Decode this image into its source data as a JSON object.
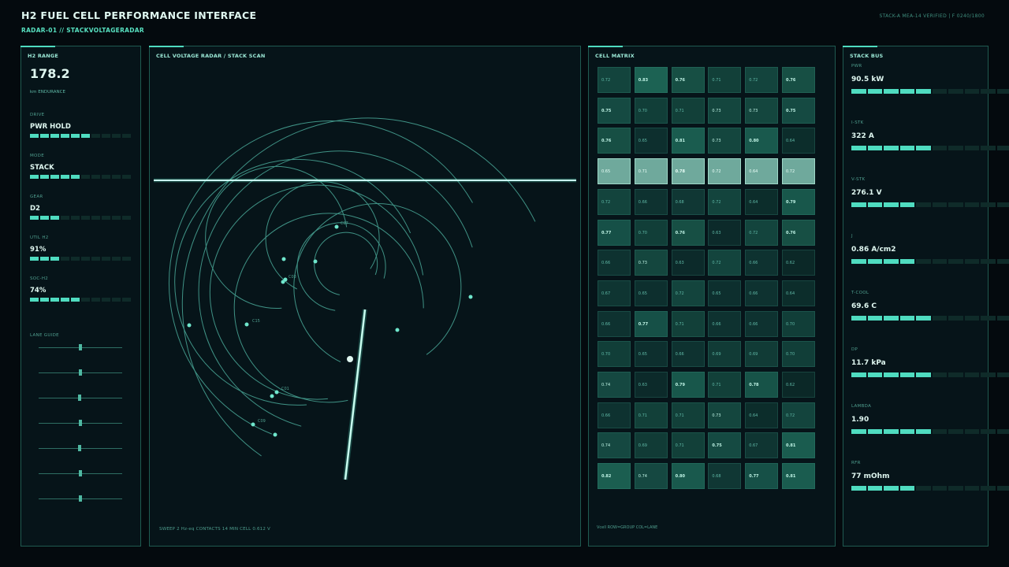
{
  "header": {
    "title": "H2 FUEL CELL PERFORMANCE INTERFACE",
    "subtitle": "RADAR-01 // STACKVOLTAGERADAR",
    "status": "STACK-A MEA-14 VERIFIED | F 0240/1800"
  },
  "left": {
    "title": "H2 RANGE",
    "range_value": "178.2",
    "range_unit": "km ENDURANCE",
    "metrics": [
      {
        "label": "DRIVE",
        "value": "PWR HOLD",
        "level": 0.6
      },
      {
        "label": "MODE",
        "value": "STACK",
        "level": 0.5
      },
      {
        "label": "GEAR",
        "value": "D2",
        "level": 0.3
      },
      {
        "label": "UTIL H2",
        "value": "91%",
        "level": 0.3
      },
      {
        "label": "SOC-H2",
        "value": "74%",
        "level": 0.5
      }
    ],
    "lane_title": "LANE GUIDE",
    "lane_levels": [
      0.5,
      0.5,
      0.49,
      0.5,
      0.49,
      0.5,
      0.5
    ]
  },
  "radar": {
    "title": "CELL VOLTAGE RADAR / STACK SCAN",
    "footer": "SWEEP  2 Hz-eq   CONTACTS 14   MIN CELL 0.612 V",
    "contacts": [
      "C07",
      "C03",
      "C15",
      "C01",
      "C09"
    ]
  },
  "matrix": {
    "title": "CELL MATRIX",
    "footer": "Vcell  ROW=GROUP  COL=LANE",
    "highlight_row": 3,
    "rows": [
      [
        "0.72",
        "0.83",
        "0.76",
        "0.71",
        "0.72",
        "0.76"
      ],
      [
        "0.75",
        "0.70",
        "0.71",
        "0.73",
        "0.73",
        "0.75"
      ],
      [
        "0.76",
        "0.65",
        "0.81",
        "0.73",
        "0.80",
        "0.64"
      ],
      [
        "0.65",
        "0.71",
        "0.78",
        "0.72",
        "0.64",
        "0.72"
      ],
      [
        "0.72",
        "0.66",
        "0.68",
        "0.72",
        "0.64",
        "0.79"
      ],
      [
        "0.77",
        "0.70",
        "0.76",
        "0.63",
        "0.72",
        "0.76"
      ],
      [
        "0.66",
        "0.73",
        "0.63",
        "0.72",
        "0.66",
        "0.62"
      ],
      [
        "0.67",
        "0.65",
        "0.72",
        "0.65",
        "0.66",
        "0.64"
      ],
      [
        "0.66",
        "0.77",
        "0.71",
        "0.66",
        "0.66",
        "0.70"
      ],
      [
        "0.70",
        "0.65",
        "0.66",
        "0.69",
        "0.69",
        "0.70"
      ],
      [
        "0.74",
        "0.63",
        "0.79",
        "0.71",
        "0.78",
        "0.62"
      ],
      [
        "0.66",
        "0.71",
        "0.71",
        "0.73",
        "0.64",
        "0.72"
      ],
      [
        "0.74",
        "0.69",
        "0.71",
        "0.75",
        "0.67",
        "0.81"
      ],
      [
        "0.82",
        "0.74",
        "0.80",
        "0.68",
        "0.77",
        "0.81"
      ]
    ]
  },
  "bus": {
    "title": "STACK BUS",
    "metrics": [
      {
        "label": "PWR",
        "value": "90.5 kW",
        "level": 0.5
      },
      {
        "label": "I-STK",
        "value": "322 A",
        "level": 0.5
      },
      {
        "label": "V-STK",
        "value": "276.1 V",
        "level": 0.4
      },
      {
        "label": "J",
        "value": "0.86 A/cm2",
        "level": 0.4
      },
      {
        "label": "T-COOL",
        "value": "69.6 C",
        "level": 0.5
      },
      {
        "label": "DP",
        "value": "11.7 kPa",
        "level": 0.5
      },
      {
        "label": "LAMBDA",
        "value": "1.90",
        "level": 0.5
      },
      {
        "label": "RFR",
        "value": "77 mOhm",
        "level": 0.4
      }
    ]
  },
  "colors": {
    "accent": "#4fdcc0",
    "panel_bg": "#061419",
    "page_bg": "#040a0e"
  }
}
